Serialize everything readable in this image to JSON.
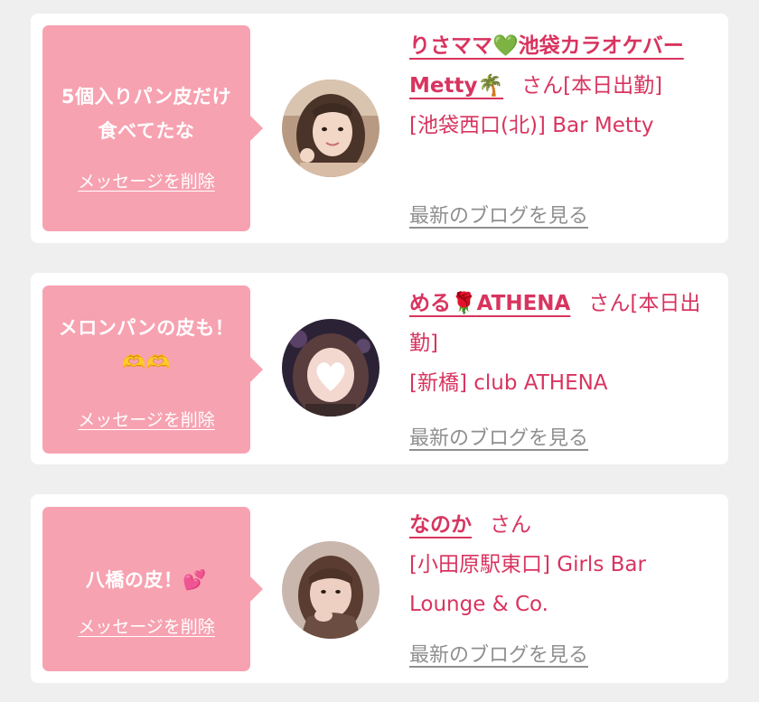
{
  "cards": [
    {
      "message": "5個入りパン皮だけ食べてたな",
      "delete_label": "メッセージを削除",
      "name_part1": "りさママ",
      "name_emoji1": "💚",
      "name_part2": "池袋カラオケバーMetty",
      "name_emoji2": "🌴",
      "suffix": "さん[本日出勤]",
      "location": "[池袋西口(北)] Bar Metty",
      "blog_label": "最新のブログを見る",
      "avatar_icon": "woman-photo-avatar"
    },
    {
      "message": "メロンパンの皮も！🫶🫶",
      "delete_label": "メッセージを削除",
      "name_part1": "める",
      "name_emoji1": "🌹",
      "name_part2": "ATHENA",
      "name_emoji2": "",
      "suffix": "さん[本日出勤]",
      "location": "[新橋] club ATHENA",
      "blog_label": "最新のブログを見る",
      "avatar_icon": "woman-photo-heart-avatar"
    },
    {
      "message": "八橋の皮！💕",
      "delete_label": "メッセージを削除",
      "name_part1": "なのか",
      "name_emoji1": "",
      "name_part2": "",
      "name_emoji2": "",
      "suffix": "さん",
      "location": "[小田原駅東口] Girls Bar Lounge & Co.",
      "blog_label": "最新のブログを見る",
      "avatar_icon": "woman-photo-avatar"
    }
  ],
  "colors": {
    "background": "#efefef",
    "card": "#ffffff",
    "bubble": "#f7a2b1",
    "accent": "#d8345f",
    "link_gray": "#8f8f8f"
  }
}
